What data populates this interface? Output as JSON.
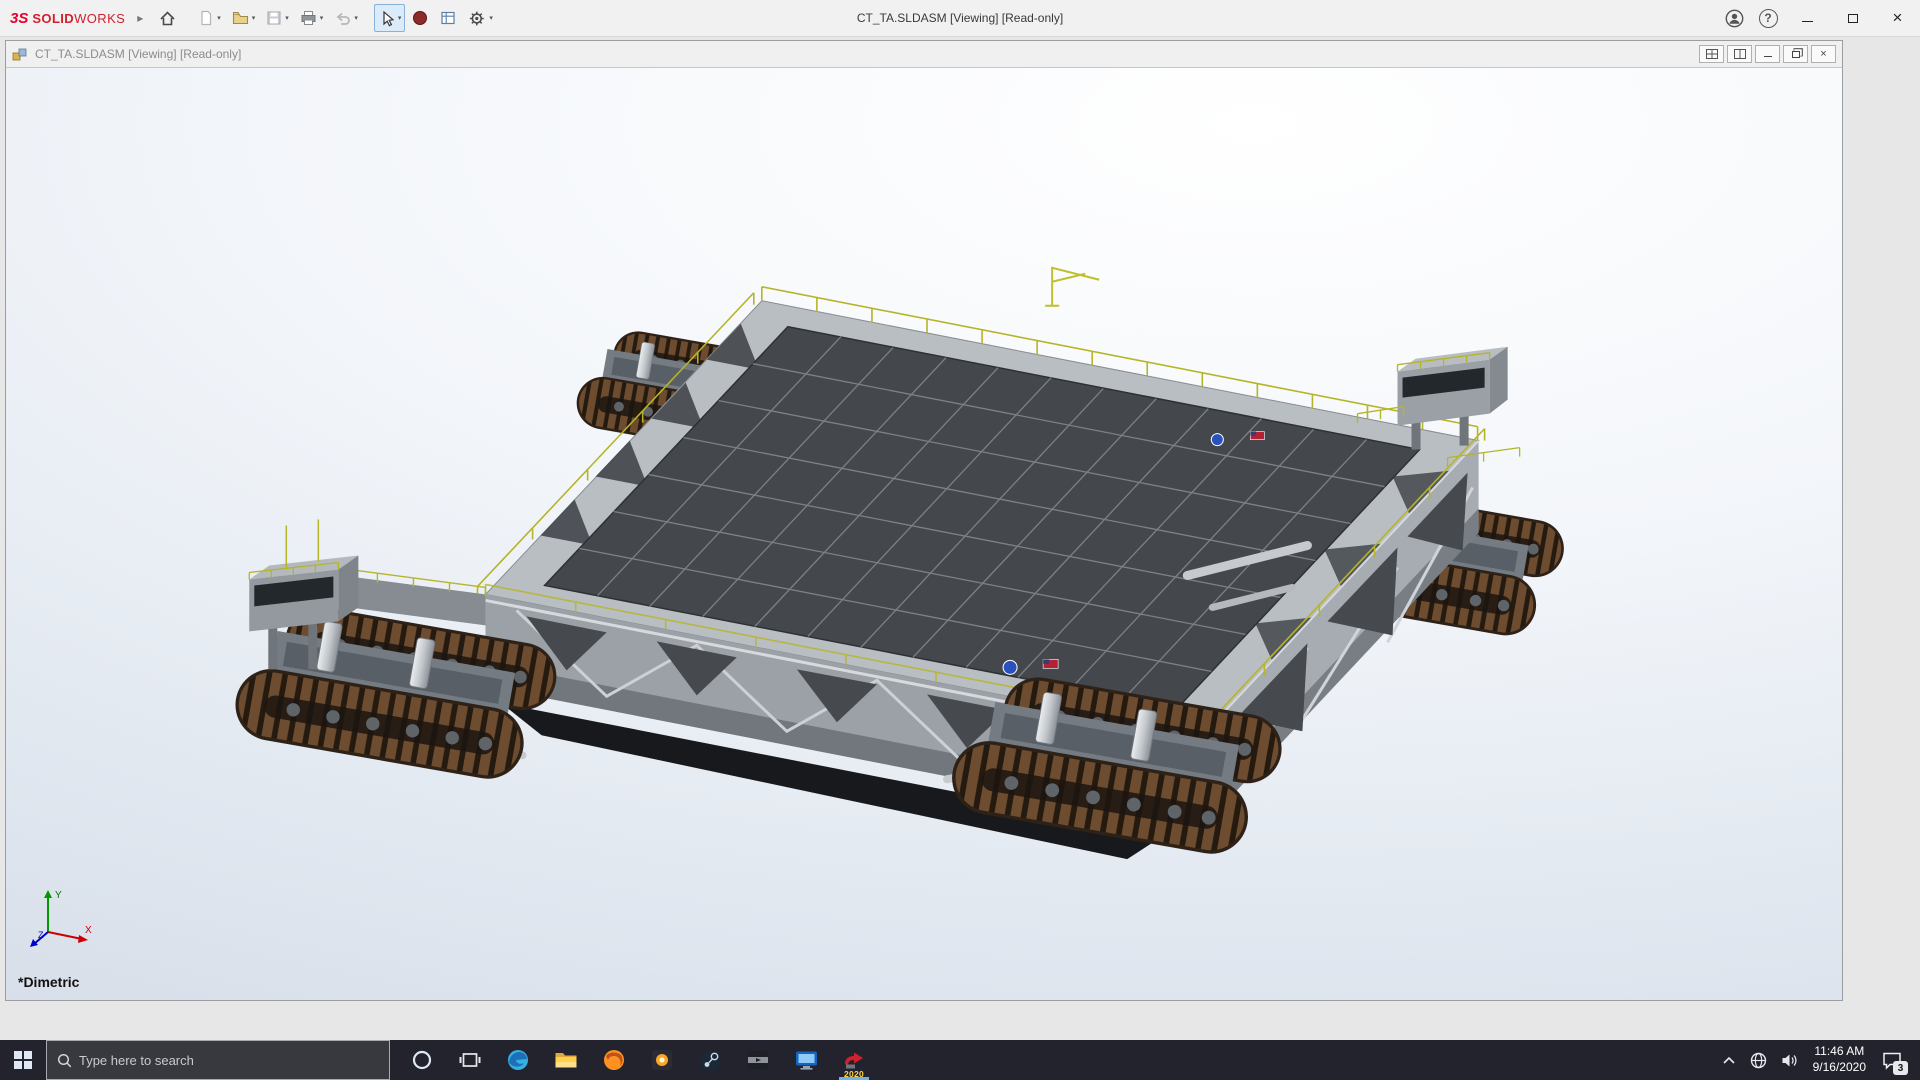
{
  "app": {
    "title": "CT_TA.SLDASM [Viewing] [Read-only]",
    "brand_bold": "SOLID",
    "brand_light": "WORKS",
    "brand_mark": "3S",
    "toolbar_icons": [
      "home",
      "new-document",
      "open",
      "save",
      "print",
      "undo",
      "select",
      "record-macro",
      "evaluate",
      "options"
    ]
  },
  "document_window": {
    "title": "CT_TA.SLDASM [Viewing] [Read-only]",
    "view_orientation": "*Dimetric",
    "triad": {
      "x": "X",
      "y": "Y",
      "z": "Z"
    }
  },
  "model": {
    "colors": {
      "deck_gray": "#b9bec3",
      "panel_gray": "#44484c",
      "face_gray": "#9ba1a7",
      "track_brown": "#6d4c2f",
      "track_dark": "#241a10",
      "railing_yellow": "#b5b529",
      "nasa_blue": "#2a52be",
      "flag_red": "#b22234"
    }
  },
  "taskbar": {
    "search_placeholder": "Type here to search",
    "pinned_apps": [
      "cortana",
      "task-view",
      "edge",
      "file-explorer",
      "firefox",
      "photos",
      "steam",
      "media-player",
      "remote-desktop",
      "solidworks"
    ],
    "solidworks_version_badge": "2020",
    "tray": {
      "time": "11:46 AM",
      "date": "9/16/2020",
      "notification_count": "3"
    }
  },
  "colors": {
    "titlebar": "#f1f1f1",
    "taskbar": "#23232e",
    "viewport_top": "#ffffff",
    "viewport_bottom": "#d6dde8"
  }
}
